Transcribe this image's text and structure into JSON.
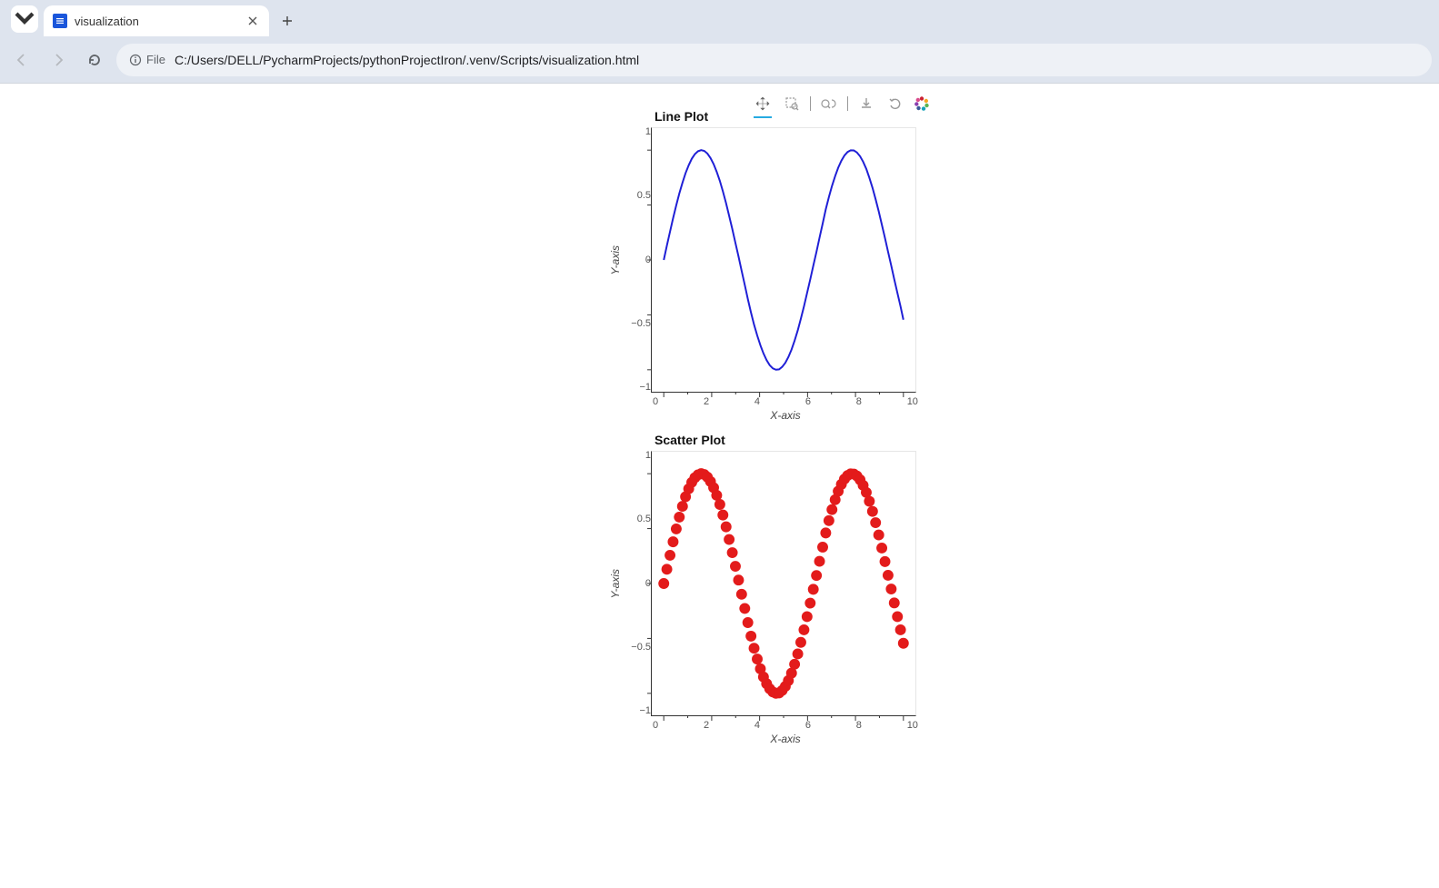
{
  "browser": {
    "tab_title": "visualization",
    "url_scheme_label": "File",
    "url": "C:/Users/DELL/PycharmProjects/pythonProjectIron/.venv/Scripts/visualization.html"
  },
  "bokeh_tools": {
    "pan": "Pan",
    "box_zoom": "Box Zoom",
    "wheel_zoom": "Wheel Zoom",
    "save": "Save",
    "reset": "Reset",
    "logo": "Bokeh"
  },
  "chart_data": [
    {
      "type": "line",
      "title": "Line Plot",
      "xlabel": "X-axis",
      "ylabel": "Y-axis",
      "xlim": [
        -0.5,
        10.5
      ],
      "ylim": [
        -1.2,
        1.2
      ],
      "xticks": [
        0,
        2,
        4,
        6,
        8,
        10
      ],
      "yticks": [
        -1,
        -0.5,
        0,
        0.5,
        1
      ],
      "color": "#1f1fd6",
      "x": [
        0,
        0.13,
        0.26,
        0.39,
        0.52,
        0.65,
        0.78,
        0.91,
        1.04,
        1.17,
        1.3,
        1.43,
        1.56,
        1.69,
        1.82,
        1.95,
        2.08,
        2.21,
        2.34,
        2.47,
        2.6,
        2.73,
        2.86,
        2.99,
        3.12,
        3.25,
        3.38,
        3.51,
        3.64,
        3.77,
        3.9,
        4.03,
        4.16,
        4.29,
        4.42,
        4.55,
        4.68,
        4.81,
        4.94,
        5.07,
        5.2,
        5.33,
        5.46,
        5.59,
        5.72,
        5.85,
        5.98,
        6.11,
        6.24,
        6.37,
        6.5,
        6.63,
        6.76,
        6.89,
        7.02,
        7.15,
        7.28,
        7.41,
        7.54,
        7.67,
        7.8,
        7.93,
        8.06,
        8.19,
        8.32,
        8.45,
        8.58,
        8.71,
        8.84,
        8.97,
        9.1,
        9.23,
        9.36,
        9.49,
        9.62,
        9.75,
        9.88,
        10
      ],
      "y": [
        0,
        0.13,
        0.257,
        0.38,
        0.497,
        0.605,
        0.703,
        0.79,
        0.862,
        0.921,
        0.964,
        0.99,
        0.9999,
        0.993,
        0.969,
        0.929,
        0.873,
        0.803,
        0.72,
        0.624,
        0.516,
        0.401,
        0.281,
        0.157,
        0.031,
        -0.098,
        -0.227,
        -0.356,
        -0.479,
        -0.589,
        -0.688,
        -0.777,
        -0.851,
        -0.912,
        -0.958,
        -0.987,
        -0.9998,
        -0.996,
        -0.974,
        -0.937,
        -0.884,
        -0.816,
        -0.735,
        -0.641,
        -0.536,
        -0.422,
        -0.302,
        -0.178,
        -0.053,
        0.073,
        0.202,
        0.331,
        0.46,
        0.573,
        0.673,
        0.763,
        0.84,
        0.903,
        0.951,
        0.983,
        0.999,
        0.997,
        0.979,
        0.944,
        0.894,
        0.829,
        0.749,
        0.657,
        0.554,
        0.442,
        0.323,
        0.2,
        0.075,
        -0.05,
        -0.177,
        -0.302,
        -0.422,
        -0.544
      ]
    },
    {
      "type": "scatter",
      "title": "Scatter Plot",
      "xlabel": "X-axis",
      "ylabel": "Y-axis",
      "xlim": [
        -0.5,
        10.5
      ],
      "ylim": [
        -1.2,
        1.2
      ],
      "xticks": [
        0,
        2,
        4,
        6,
        8,
        10
      ],
      "yticks": [
        -1,
        -0.5,
        0,
        0.5,
        1
      ],
      "color": "#e31b1b",
      "marker_radius_px": 6,
      "x": [
        0,
        0.13,
        0.26,
        0.39,
        0.52,
        0.65,
        0.78,
        0.91,
        1.04,
        1.17,
        1.3,
        1.43,
        1.56,
        1.69,
        1.82,
        1.95,
        2.08,
        2.21,
        2.34,
        2.47,
        2.6,
        2.73,
        2.86,
        2.99,
        3.12,
        3.25,
        3.38,
        3.51,
        3.64,
        3.77,
        3.9,
        4.03,
        4.16,
        4.29,
        4.42,
        4.55,
        4.68,
        4.81,
        4.94,
        5.07,
        5.2,
        5.33,
        5.46,
        5.59,
        5.72,
        5.85,
        5.98,
        6.11,
        6.24,
        6.37,
        6.5,
        6.63,
        6.76,
        6.89,
        7.02,
        7.15,
        7.28,
        7.41,
        7.54,
        7.67,
        7.8,
        7.93,
        8.06,
        8.19,
        8.32,
        8.45,
        8.58,
        8.71,
        8.84,
        8.97,
        9.1,
        9.23,
        9.36,
        9.49,
        9.62,
        9.75,
        9.88,
        10
      ],
      "y": [
        0,
        0.13,
        0.257,
        0.38,
        0.497,
        0.605,
        0.703,
        0.79,
        0.862,
        0.921,
        0.964,
        0.99,
        0.9999,
        0.993,
        0.969,
        0.929,
        0.873,
        0.803,
        0.72,
        0.624,
        0.516,
        0.401,
        0.281,
        0.157,
        0.031,
        -0.098,
        -0.227,
        -0.356,
        -0.479,
        -0.589,
        -0.688,
        -0.777,
        -0.851,
        -0.912,
        -0.958,
        -0.987,
        -0.9998,
        -0.996,
        -0.974,
        -0.937,
        -0.884,
        -0.816,
        -0.735,
        -0.641,
        -0.536,
        -0.422,
        -0.302,
        -0.178,
        -0.053,
        0.073,
        0.202,
        0.331,
        0.46,
        0.573,
        0.673,
        0.763,
        0.84,
        0.903,
        0.951,
        0.983,
        0.999,
        0.997,
        0.979,
        0.944,
        0.894,
        0.829,
        0.749,
        0.657,
        0.554,
        0.442,
        0.323,
        0.2,
        0.075,
        -0.05,
        -0.177,
        -0.302,
        -0.422,
        -0.544
      ]
    }
  ]
}
